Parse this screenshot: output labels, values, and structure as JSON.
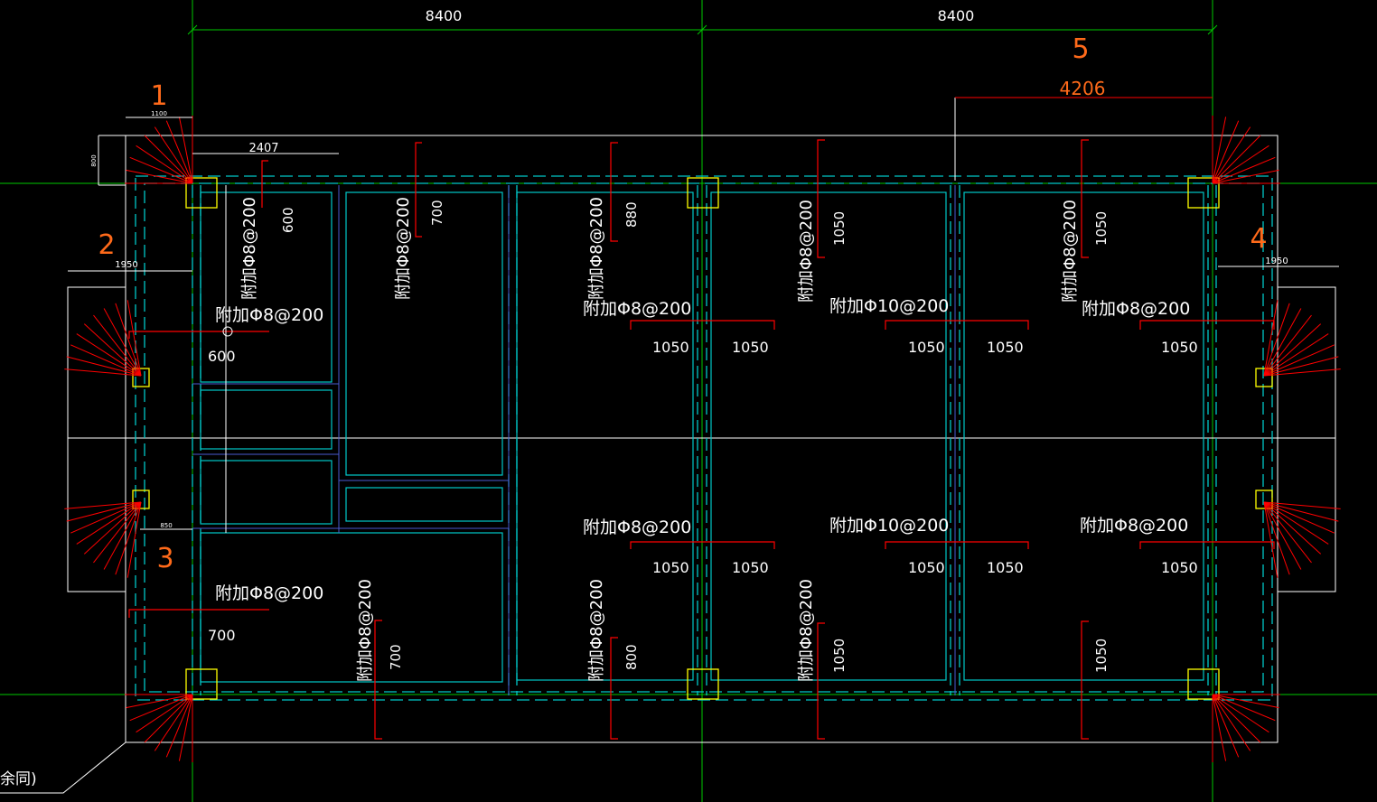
{
  "colors": {
    "background": "#000000",
    "grid": "#00c800",
    "outline": "#ffffff",
    "beam": "#00c8c8",
    "beam_inner": "#4a5ad0",
    "rebar": "#ff0000",
    "column": "#ffff00",
    "callout": "#ff6a1a",
    "text": "#ffffff"
  },
  "dims": {
    "top_left": "8400",
    "top_right": "8400",
    "span_5": "4206",
    "col_a": "2407",
    "col_b": "1100",
    "left_small": "800",
    "left_1": "1950",
    "right_4": "1950",
    "small_850": "850"
  },
  "callouts": [
    "1",
    "2",
    "3",
    "4",
    "5"
  ],
  "top_labels": [
    {
      "text": "附加Φ8@200",
      "len": "600"
    },
    {
      "text": "附加Φ8@200",
      "len": "700"
    },
    {
      "text": "附加Φ8@200",
      "len": "880"
    },
    {
      "text": "附加Φ8@200",
      "len": "1050"
    },
    {
      "text": "附加Φ8@200",
      "len": "1050"
    }
  ],
  "row1": {
    "left": "附加Φ8@200",
    "left_len": "600",
    "mid": "附加Φ8@200",
    "right": "附加Φ10@200",
    "far": "附加Φ8@200",
    "v1": "1050",
    "v2": "1050",
    "v3": "1050",
    "v4": "1050",
    "v5": "1050"
  },
  "row2": {
    "mid": "附加Φ8@200",
    "right": "附加Φ10@200",
    "far": "附加Φ8@200",
    "v1": "1050",
    "v2": "1050",
    "v3": "1050",
    "v4": "1050",
    "v5": "1050"
  },
  "bottom_left": {
    "text": "附加Φ8@200",
    "len": "700"
  },
  "bottom_labels": [
    {
      "text": "附加Φ8@200",
      "len": "700"
    },
    {
      "text": "附加Φ8@200",
      "len": "800"
    },
    {
      "text": "附加Φ8@200",
      "len": "1050"
    },
    {
      "text": "",
      "len": "1050"
    }
  ],
  "note": "余同)"
}
